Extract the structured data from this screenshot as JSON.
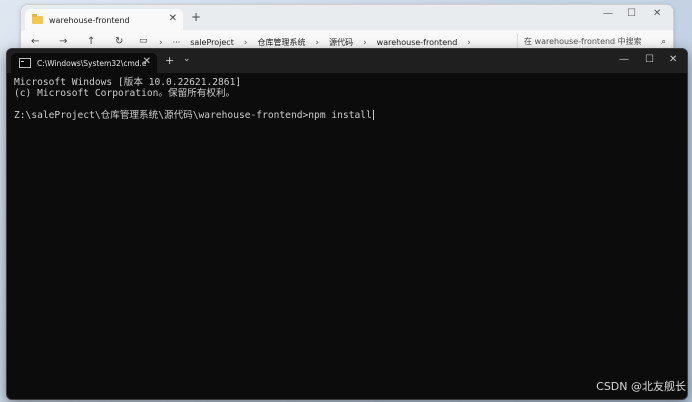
{
  "explorer": {
    "tab_title": "warehouse-frontend",
    "breadcrumbs": [
      "saleProject",
      "仓库管理系统",
      "源代码",
      "warehouse-frontend"
    ],
    "ellipsis": "···",
    "search_placeholder": "在 warehouse-frontend 中搜索"
  },
  "terminal": {
    "tab_title": "C:\\Windows\\System32\\cmd.e",
    "lines": [
      "Microsoft Windows [版本 10.0.22621.2861]",
      "(c) Microsoft Corporation。保留所有权利。",
      "",
      "Z:\\saleProject\\仓库管理系统\\源代码\\warehouse-frontend>npm install"
    ]
  },
  "watermark": "CSDN @北友舰长",
  "colors": {
    "terminal_bg": "#0c0c0c",
    "terminal_text": "#cccccc",
    "folder": "#f2c94c"
  },
  "icons": [
    "folder-icon",
    "close-icon",
    "plus-icon",
    "minimize-icon",
    "maximize-icon",
    "back-arrow-icon",
    "forward-arrow-icon",
    "up-arrow-icon",
    "refresh-icon",
    "monitor-icon",
    "chevron-right-icon",
    "search-icon",
    "cmd-icon",
    "chevron-down-icon"
  ]
}
